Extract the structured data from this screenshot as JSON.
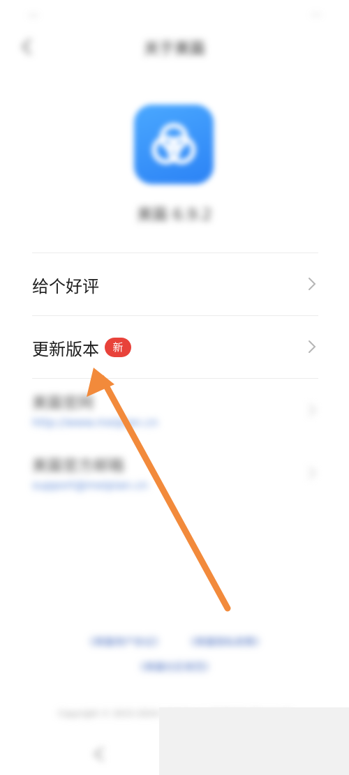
{
  "status_bar": {
    "left": "...",
    "right": "..."
  },
  "header": {
    "title": "关于美篇"
  },
  "app": {
    "name": "美篇 6.9.2"
  },
  "list": {
    "rate": {
      "label": "给个好评"
    },
    "update": {
      "label": "更新版本",
      "badge": "新"
    },
    "website": {
      "label": "美篇官网",
      "url": "http://www.meipian.cn"
    },
    "email": {
      "label": "美篇官方邮箱",
      "url": "support@meipian.cn"
    }
  },
  "footer": {
    "link1": "《美篇用户协议》",
    "link2": "《美篇隐私政策》",
    "link3": "《美篇社区规范》",
    "copyright": "Copyright © 2015-2024 meipian.cn All Rights Reserved"
  },
  "annotation": {
    "arrow_color": "#f28a3b"
  }
}
